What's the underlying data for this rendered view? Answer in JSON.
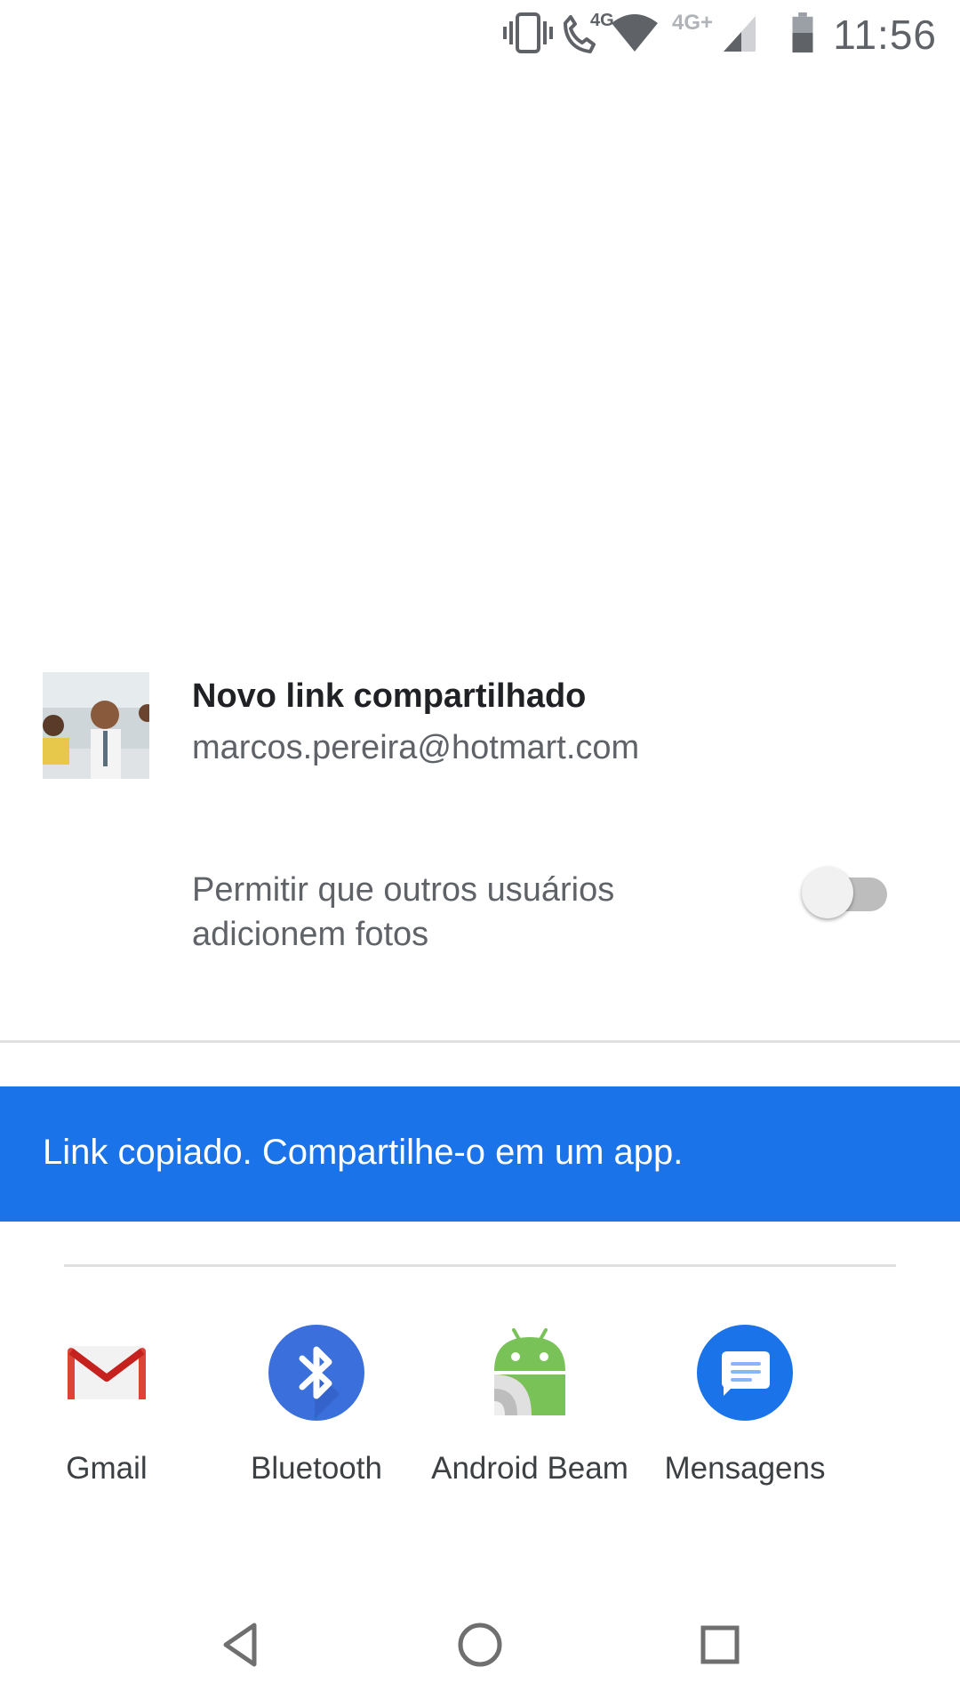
{
  "status_bar": {
    "time": "11:56",
    "icons": [
      "vibrate-icon",
      "volte-call-icon",
      "wifi-icon",
      "cellular-signal-icon",
      "battery-icon"
    ],
    "call_network": "4G",
    "signal_network": "4G+"
  },
  "share_sheet": {
    "title": "Novo link compartilhado",
    "account": "marcos.pereira@hotmart.com",
    "toggle_label": "Permitir que outros usuários adicionem fotos",
    "toggle_on": false,
    "banner_text": "Link copiado. Compartilhe-o em um app.",
    "banner_color": "#1a73e8",
    "apps": [
      {
        "label": "Gmail",
        "icon": "gmail-icon"
      },
      {
        "label": "Bluetooth",
        "icon": "bluetooth-icon"
      },
      {
        "label": "Android Beam",
        "icon": "android-beam-icon"
      },
      {
        "label": "Mensagens",
        "icon": "messages-icon"
      }
    ]
  },
  "navigation": {
    "buttons": [
      "back-icon",
      "home-icon",
      "recents-icon"
    ]
  }
}
